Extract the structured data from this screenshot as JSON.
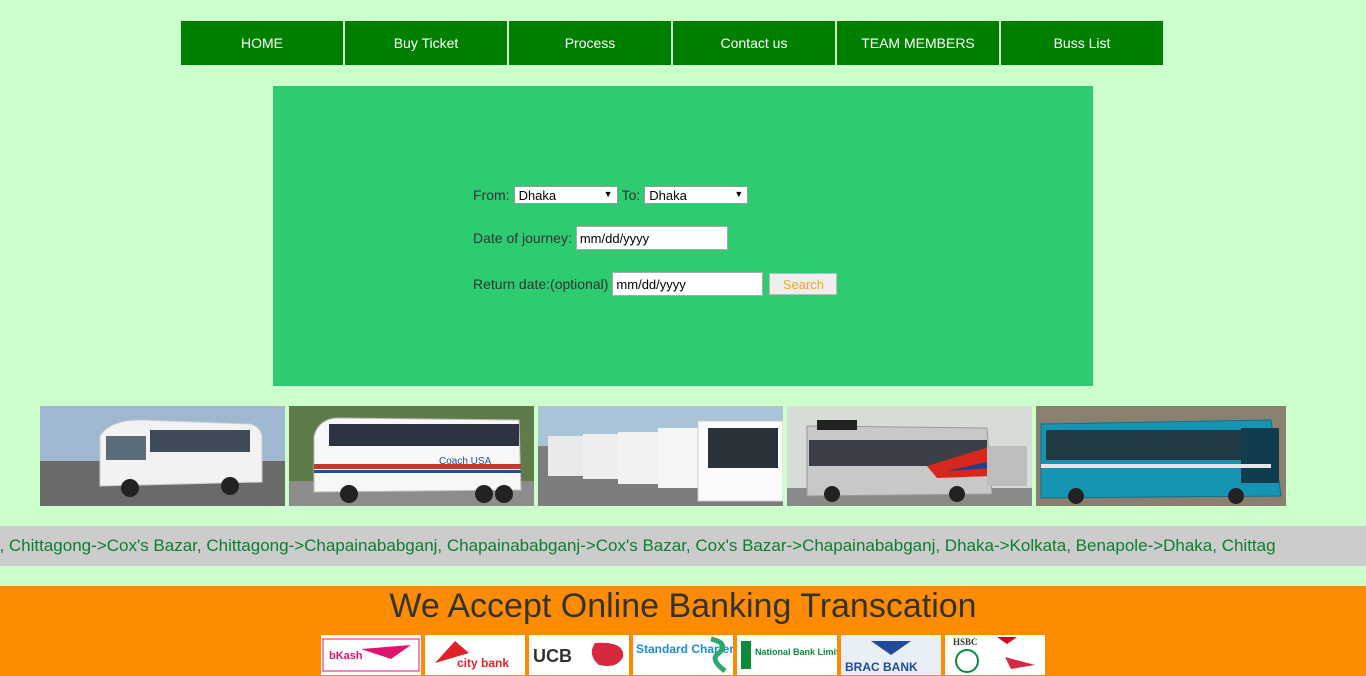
{
  "nav": {
    "items": [
      {
        "label": "HOME"
      },
      {
        "label": "Buy Ticket"
      },
      {
        "label": "Process"
      },
      {
        "label": "Contact us"
      },
      {
        "label": "TEAM MEMBERS"
      },
      {
        "label": "Buss List"
      }
    ]
  },
  "search": {
    "from_label": "From:",
    "from_value": "Dhaka",
    "to_label": "To:",
    "to_value": "Dhaka",
    "date_label": "Date of journey:",
    "date_value": "mm/dd/yyyy",
    "return_label": "Return date:(optional)",
    "return_value": "mm/dd/yyyy",
    "search_label": "Search"
  },
  "routes_ticker": "g, Chittagong->Cox's Bazar, Chittagong->Chapainababganj, Chapainababganj->Cox's Bazar, Cox's Bazar->Chapainababganj, Dhaka->Kolkata, Benapole->Dhaka, Chittag",
  "bank": {
    "title": "We Accept Online Banking Transcation",
    "logos": [
      {
        "text": "bKash"
      },
      {
        "text": "city bank"
      },
      {
        "text": "UCB"
      },
      {
        "text": "Standard Chartered"
      },
      {
        "text": "National Bank Limited"
      },
      {
        "text": "BRAC BANK"
      },
      {
        "text": "HSBC"
      }
    ]
  },
  "gallery": {
    "images": [
      {
        "caption": "Coach USA"
      }
    ]
  },
  "colors": {
    "nav_bg": "#008000",
    "page_bg": "#ccffcc",
    "panel_bg": "#2ecc71",
    "footer_bg": "#ff8c00"
  }
}
